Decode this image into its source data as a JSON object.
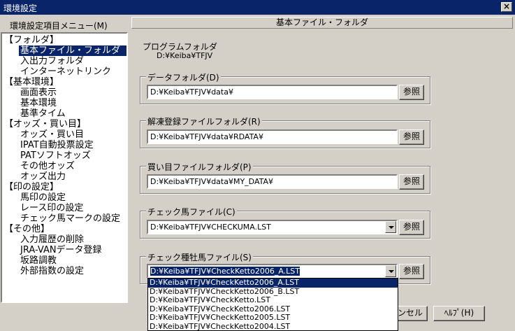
{
  "window": {
    "title": "環境設定",
    "close": "×"
  },
  "menu_label": "環境設定項目メニュー(M)",
  "tree": [
    {
      "label": "【フォルダ】",
      "type": "cat"
    },
    {
      "label": "基本ファイル・フォルダ",
      "type": "selected"
    },
    {
      "label": "入出力フォルダ",
      "type": "sub"
    },
    {
      "label": "インターネットリンク",
      "type": "sub"
    },
    {
      "label": "【基本環境】",
      "type": "cat"
    },
    {
      "label": "画面表示",
      "type": "sub"
    },
    {
      "label": "基本環境",
      "type": "sub"
    },
    {
      "label": "基準タイム",
      "type": "sub"
    },
    {
      "label": "【オッズ・買い目】",
      "type": "cat"
    },
    {
      "label": "オッズ・買い目",
      "type": "sub"
    },
    {
      "label": "IPAT自動投票設定",
      "type": "sub"
    },
    {
      "label": "PATソフトオッズ",
      "type": "sub"
    },
    {
      "label": "その他オッズ",
      "type": "sub"
    },
    {
      "label": "オッズ出力",
      "type": "sub"
    },
    {
      "label": "【印の設定】",
      "type": "cat"
    },
    {
      "label": "馬印の設定",
      "type": "sub"
    },
    {
      "label": "レース印の設定",
      "type": "sub"
    },
    {
      "label": "チェック馬マークの設定",
      "type": "sub"
    },
    {
      "label": "【その他】",
      "type": "cat"
    },
    {
      "label": "入力履歴の削除",
      "type": "sub"
    },
    {
      "label": "JRA-VANデータ登録",
      "type": "sub"
    },
    {
      "label": "坂路調教",
      "type": "sub"
    },
    {
      "label": "外部指数の設定",
      "type": "sub"
    }
  ],
  "panel": {
    "header": "基本ファイル・フォルダ",
    "program_folder_label": "プログラムフォルダ",
    "program_folder_value": "D:¥Keiba¥TFJV",
    "browse_label": "参照",
    "data_folder": {
      "title": "データフォルダ(D)",
      "value": "D:¥Keiba¥TFJV¥data¥"
    },
    "kaitou_folder": {
      "title": "解凍登録ファイルフォルダ(R)",
      "value": "D:¥Keiba¥TFJV¥data¥RDATA¥"
    },
    "kaime_folder": {
      "title": "買い目ファイルフォルダ(P)",
      "value": "D:¥Keiba¥TFJV¥data¥MY_DATA¥"
    },
    "check_uma_file": {
      "title": "チェック馬ファイル(C)",
      "value": "D:¥Keiba¥TFJV¥CHECKUMA.LST"
    },
    "check_shuboba_file": {
      "title": "チェック種牡馬ファイル(S)",
      "value": "D:¥Keiba¥TFJV¥CheckKetto2006_A.LST"
    }
  },
  "dropdown_options": [
    "D:¥Keiba¥TFJV¥CheckKetto2006_A.LST",
    "D:¥Keiba¥TFJV¥CheckKetto2006_B.LST",
    "D:¥Keiba¥TFJV¥CheckKetto.LST",
    "D:¥Keiba¥TFJV¥CheckKetto2006.LST",
    "D:¥Keiba¥TFJV¥CheckKetto2005.LST",
    "D:¥Keiba¥TFJV¥CheckKetto2004.LST"
  ],
  "buttons": {
    "cancel_partial": "ャンセル",
    "help": "ﾍﾙﾌﾟ(H)"
  }
}
